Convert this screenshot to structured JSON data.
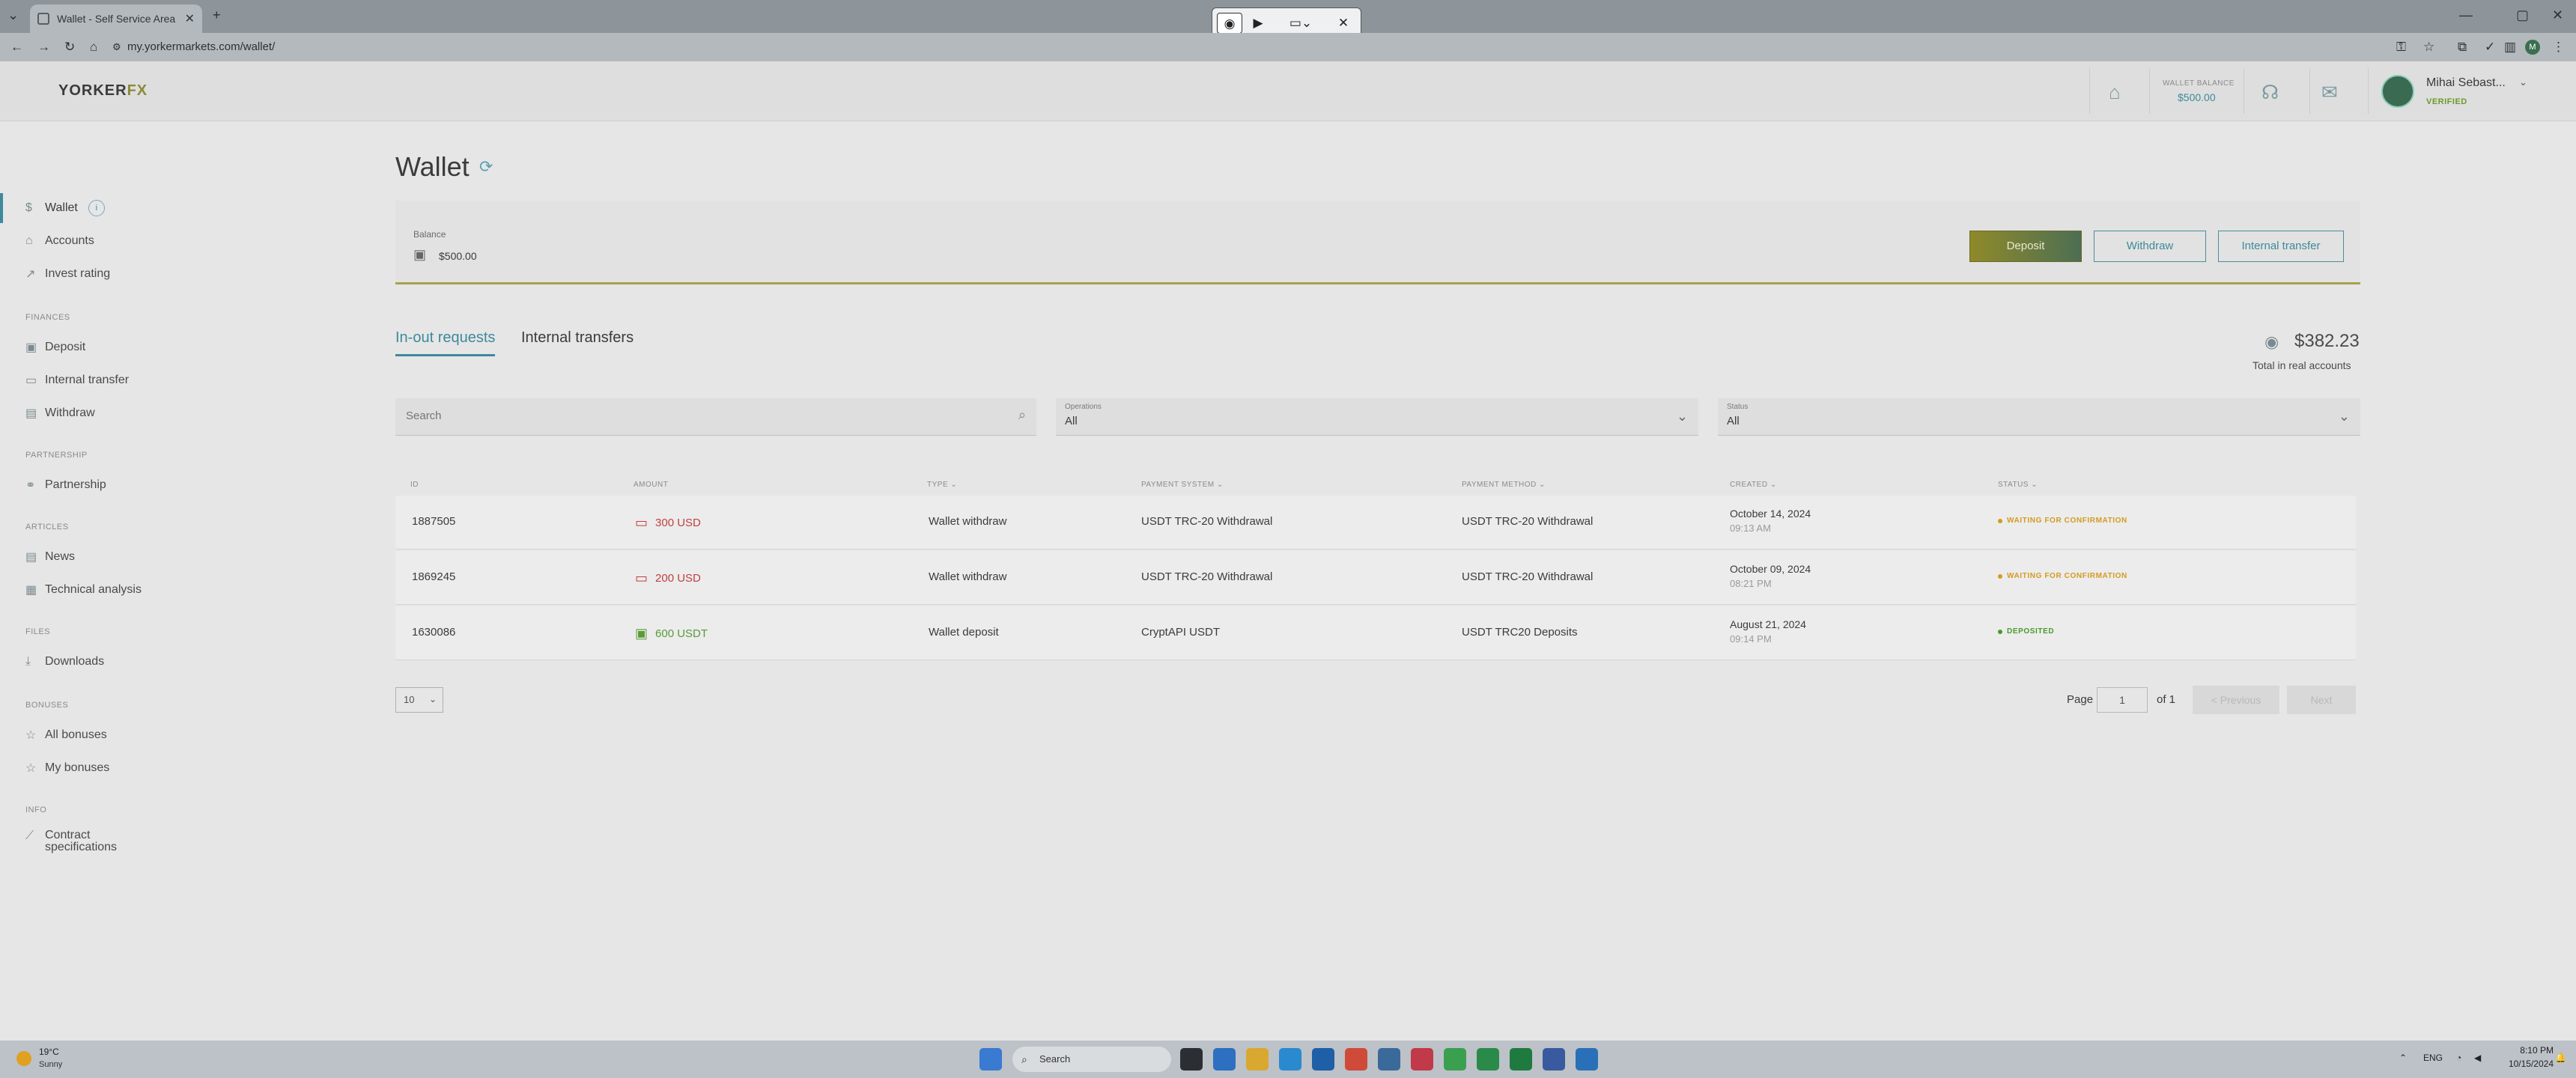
{
  "browser": {
    "tab_title": "Wallet - Self Service Area | Yor",
    "url": "my.yorkermarkets.com/wallet/"
  },
  "header": {
    "logo": "YORKER",
    "logo_suffix": "FX",
    "wallet_balance_label": "WALLET BALANCE",
    "wallet_balance_value": "$500.00",
    "user_name": "Mihai Sebast...",
    "user_status": "VERIFIED"
  },
  "sidebar": {
    "wallet_label": "Wallet",
    "wallet_badge": "i",
    "accounts": "Accounts",
    "invest_rating": "Invest rating",
    "sections": {
      "finances": "FINANCES",
      "partnership": "PARTNERSHIP",
      "articles": "ARTICLES",
      "files": "FILES",
      "bonuses": "BONUSES",
      "info": "INFO"
    },
    "deposit": "Deposit",
    "internal_transfer": "Internal transfer",
    "withdraw": "Withdraw",
    "partnership": "Partnership",
    "news": "News",
    "technical_analysis": "Technical analysis",
    "downloads": "Downloads",
    "all_bonuses": "All bonuses",
    "my_bonuses": "My bonuses",
    "contract_line1": "Contract",
    "contract_line2": "specifications"
  },
  "main": {
    "title": "Wallet",
    "balance_label": "Balance",
    "balance_value": "$500.00",
    "deposit_btn": "Deposit",
    "withdraw_btn": "Withdraw",
    "internal_transfer_btn": "Internal transfer",
    "tab_inout": "In-out requests",
    "tab_internal": "Internal transfers",
    "total_value": "$382.23",
    "total_label": "Total in real accounts",
    "search_placeholder": "Search",
    "operations_label": "Operations",
    "operations_value": "All",
    "status_label": "Status",
    "status_value": "All"
  },
  "table": {
    "headers": {
      "id": "ID",
      "amount": "AMOUNT",
      "type": "TYPE ⌄",
      "payment_system": "PAYMENT SYSTEM ⌄",
      "payment_method": "PAYMENT METHOD ⌄",
      "created": "CREATED ⌄",
      "status": "STATUS ⌄"
    },
    "rows": [
      {
        "id": "1887505",
        "amount": "300 USD",
        "type": "Wallet withdraw",
        "payment_system": "USDT TRC-20 Withdrawal",
        "payment_method": "USDT TRC-20 Withdrawal",
        "created_date": "October 14, 2024",
        "created_time": "09:13 AM",
        "status": "WAITING FOR CONFIRMATION"
      },
      {
        "id": "1869245",
        "amount": "200 USD",
        "type": "Wallet withdraw",
        "payment_system": "USDT TRC-20 Withdrawal",
        "payment_method": "USDT TRC-20 Withdrawal",
        "created_date": "October 09, 2024",
        "created_time": "08:21 PM",
        "status": "WAITING FOR CONFIRMATION"
      },
      {
        "id": "1630086",
        "amount": "600 USDT",
        "type": "Wallet deposit",
        "payment_system": "CryptAPI USDT",
        "payment_method": "USDT TRC20 Deposits",
        "created_date": "August 21, 2024",
        "created_time": "09:14 PM",
        "status": "DEPOSITED"
      }
    ]
  },
  "pagination": {
    "per_page": "10",
    "page_label": "Page",
    "page_value": "1",
    "of_label": "of 1",
    "previous": "< Previous",
    "next": "Next"
  },
  "taskbar": {
    "temp": "19°C",
    "condition": "Sunny",
    "search": "Search",
    "lang": "ENG",
    "time": "8:10 PM",
    "date": "10/15/2024"
  },
  "colors": {
    "accent": "#3d8a9a",
    "pending": "#d49a20",
    "deposited": "#4a9a2a",
    "outgoing": "#c04040"
  }
}
